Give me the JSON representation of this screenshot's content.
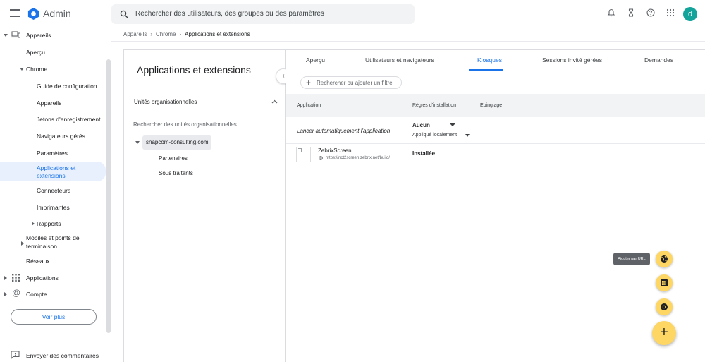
{
  "header": {
    "app_title": "Admin",
    "search_placeholder": "Rechercher des utilisateurs, des groupes ou des paramètres",
    "avatar_letter": "d"
  },
  "sidebar": {
    "items": [
      {
        "label": "Appareils"
      },
      {
        "label": "Aperçu"
      },
      {
        "label": "Chrome"
      },
      {
        "label": "Guide de configuration"
      },
      {
        "label": "Appareils"
      },
      {
        "label": "Jetons d'enregistrement"
      },
      {
        "label": "Navigateurs gérés"
      },
      {
        "label": "Paramètres"
      },
      {
        "label": "Applications et",
        "label2": "extensions"
      },
      {
        "label": "Connecteurs"
      },
      {
        "label": "Imprimantes"
      },
      {
        "label": "Rapports"
      },
      {
        "label": "Mobiles et points de",
        "label2": "terminaison"
      },
      {
        "label": "Réseaux"
      },
      {
        "label": "Applications"
      },
      {
        "label": "Compte"
      }
    ],
    "see_more": "Voir plus",
    "feedback": "Envoyer des commentaires"
  },
  "breadcrumb": {
    "items": [
      "Appareils",
      "Chrome",
      "Applications et extensions"
    ]
  },
  "left_panel": {
    "title": "Applications et extensions",
    "ou_header": "Unités organisationnelles",
    "ou_search_placeholder": "Rechercher des unités organisationnelles",
    "ou_root": "snapcom-consulting.com",
    "ou_children": [
      "Partenaires",
      "Sous traitants"
    ]
  },
  "tabs": [
    {
      "label": "Aperçu"
    },
    {
      "label": "Utilisateurs et navigateurs"
    },
    {
      "label": "Kiosques"
    },
    {
      "label": "Sessions invité gérées"
    },
    {
      "label": "Demandes"
    }
  ],
  "filter_chip": "Rechercher ou ajouter un filtre",
  "table": {
    "columns": [
      "Application",
      "Règles d'installation",
      "Épinglage"
    ],
    "autolaunch": {
      "label": "Lancer automatiquement l'application",
      "value": "Aucun",
      "applied": "Appliqué localement"
    },
    "rows": [
      {
        "name": "ZebrixScreen",
        "url": "https://nct2screen.zebrix.net/build/",
        "status": "Installée"
      }
    ]
  },
  "fab": {
    "tooltip": "Ajouter par URL",
    "main": "+"
  },
  "colors": {
    "accent": "#1a73e8",
    "fab": "#fdd663",
    "avatar": "#12a39a",
    "active_bg": "#e8f0fe"
  }
}
